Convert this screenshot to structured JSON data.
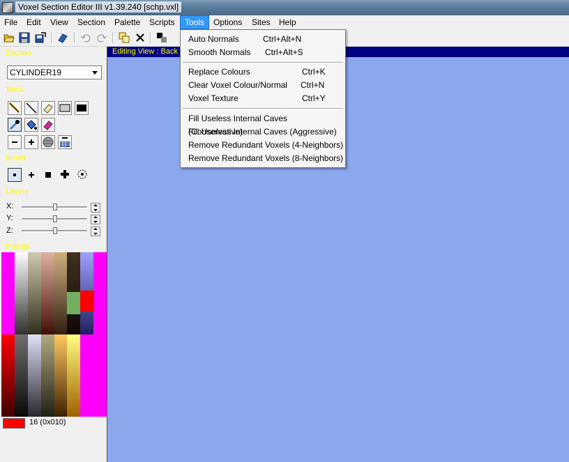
{
  "window": {
    "title": "Voxel Section Editor III v1.39.240 [schp.vxl]"
  },
  "menubar": {
    "items": [
      "File",
      "Edit",
      "View",
      "Section",
      "Palette",
      "Scripts",
      "Tools",
      "Options",
      "Sites",
      "Help"
    ],
    "open": "Tools"
  },
  "tools_menu": {
    "items": [
      {
        "label": "Auto Normals",
        "shortcut": "Ctrl+Alt+N"
      },
      {
        "label": "Smooth Normals",
        "shortcut": "Ctrl+Alt+S"
      },
      {
        "label": "Replace Colours",
        "shortcut": "Ctrl+K"
      },
      {
        "label": "Clear Voxel Colour/Normal",
        "shortcut": "Ctrl+N"
      },
      {
        "label": "Voxel Texture",
        "shortcut": "Ctrl+Y"
      },
      {
        "label": "Fill Useless Internal Caves (Conservative)",
        "shortcut": ""
      },
      {
        "label": "Fill Useless Internal Caves (Aggressive)",
        "shortcut": ""
      },
      {
        "label": "Remove Redundant Voxels (4-Neighbors)",
        "shortcut": ""
      },
      {
        "label": "Remove Redundant Voxels (8-Neighbors)",
        "shortcut": ""
      }
    ]
  },
  "left_panel": {
    "section_label": "Section",
    "section_value": "CYLINDER19",
    "tools_label": "Tools",
    "brush_label": "Brush",
    "layers_label": "Layers",
    "layers": [
      "X:",
      "Y:",
      "Z:"
    ],
    "palette_label": "Palette",
    "active_colour_text": "16 (0x010)",
    "active_colour": "#ff0000"
  },
  "editor": {
    "view_label": "Editing View : Back",
    "background": "#8ba8ee"
  },
  "colors": {
    "menu_highlight": "#3399ff",
    "view_bar": "#000080",
    "label_yellow": "#ffff00",
    "palette_bg": "#ff00ff"
  }
}
